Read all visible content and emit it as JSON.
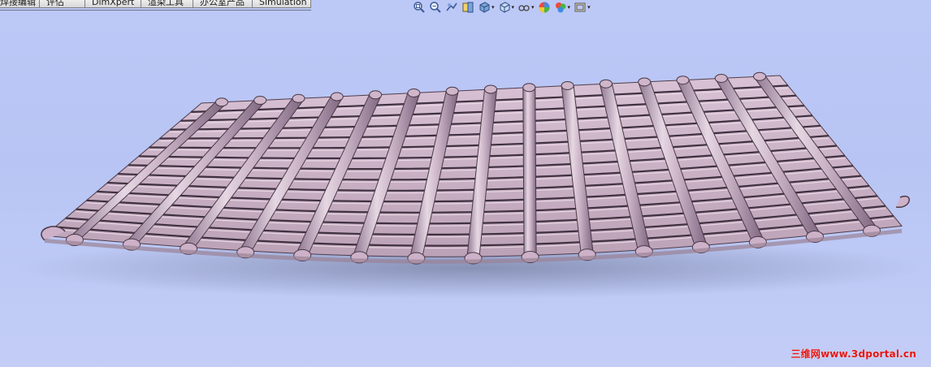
{
  "command_tabs": [
    {
      "label": "焊接编辑"
    },
    {
      "label": "评估"
    },
    {
      "label": "DimXpert"
    },
    {
      "label": "渲染工具"
    },
    {
      "label": "办公室产品"
    },
    {
      "label": "Simulation"
    }
  ],
  "view_toolbar": {
    "items": [
      {
        "icon": "zoom-to-fit-icon"
      },
      {
        "icon": "zoom-to-area-icon"
      },
      {
        "icon": "previous-view-icon"
      },
      {
        "icon": "section-view-icon"
      },
      {
        "icon": "view-orientation-icon",
        "dropdown": true
      },
      {
        "icon": "display-style-icon",
        "dropdown": true
      },
      {
        "icon": "hide-show-items-icon",
        "dropdown": true
      },
      {
        "icon": "edit-appearance-icon"
      },
      {
        "icon": "apply-scene-icon",
        "dropdown": true
      },
      {
        "icon": "view-settings-icon",
        "dropdown": true
      }
    ],
    "caret": "▾"
  },
  "model": {
    "description_color_tile": "#cdb1c8",
    "shade_color": "#9a8296"
  },
  "watermark": {
    "text": "三维网www.3dportal.cn",
    "color": "#e8130f"
  }
}
